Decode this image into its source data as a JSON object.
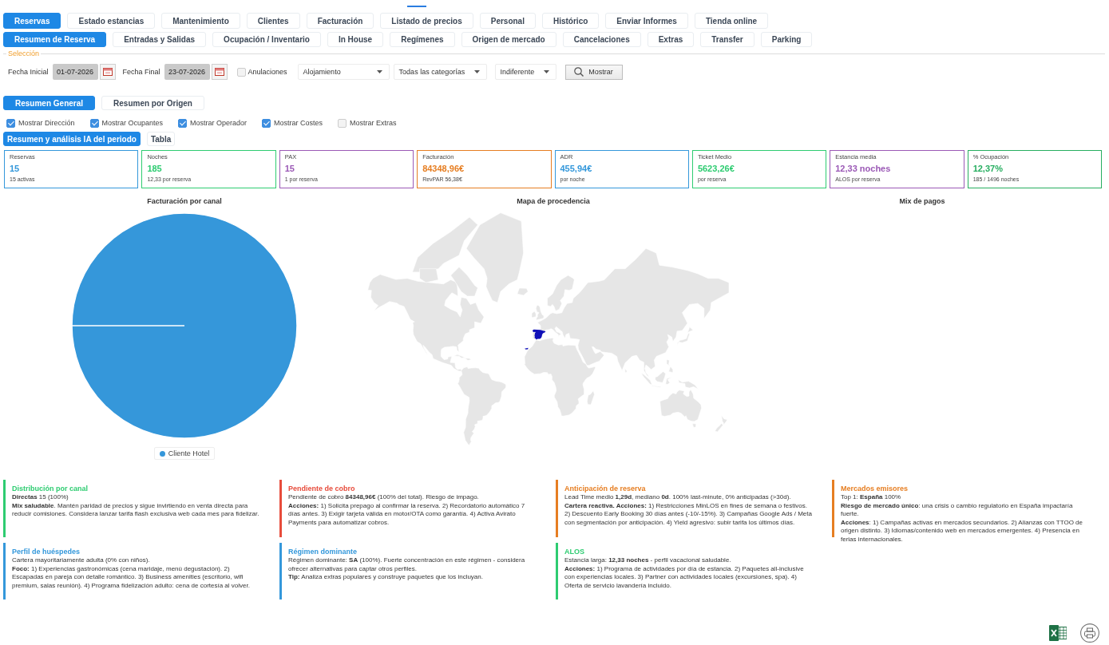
{
  "top_tabs": [
    {
      "label": "Reservas",
      "selected": true
    },
    {
      "label": "Estado estancias",
      "selected": false
    },
    {
      "label": "Mantenimiento",
      "selected": false
    },
    {
      "label": "Clientes",
      "selected": false
    },
    {
      "label": "Facturación",
      "selected": false
    },
    {
      "label": "Listado de precios",
      "selected": false
    },
    {
      "label": "Personal",
      "selected": false
    },
    {
      "label": "Histórico",
      "selected": false
    },
    {
      "label": "Enviar Informes",
      "selected": false
    },
    {
      "label": "Tienda online",
      "selected": false
    }
  ],
  "section_tabs": [
    {
      "label": "Resumen de Reserva",
      "selected": true
    },
    {
      "label": "Entradas y Salidas",
      "selected": false
    },
    {
      "label": "Ocupación / Inventario",
      "selected": false
    },
    {
      "label": "In House",
      "selected": false
    },
    {
      "label": "Regímenes",
      "selected": false
    },
    {
      "label": "Origen de mercado",
      "selected": false
    },
    {
      "label": "Cancelaciones",
      "selected": false
    },
    {
      "label": "Extras",
      "selected": false
    },
    {
      "label": "Transfer",
      "selected": false
    },
    {
      "label": "Parking",
      "selected": false
    }
  ],
  "selection": {
    "legend": "Selección",
    "start_date": {
      "label": "Fecha Inicial",
      "value": "01-07-2026"
    },
    "end_date": {
      "label": "Fecha Final",
      "value": "23-07-2026"
    },
    "cancellations": {
      "label": "Anulaciones",
      "checked": false
    },
    "dropdowns": [
      {
        "value": "Alojamiento"
      },
      {
        "value": "Todas las categorías"
      },
      {
        "value": "Indiferente"
      }
    ],
    "show_button": {
      "label": "Mostrar"
    }
  },
  "view_tabs": [
    {
      "label": "Resumen General",
      "selected": true
    },
    {
      "label": "Resumen por Origen",
      "selected": false
    }
  ],
  "display_options": [
    {
      "label": "Mostrar Dirección",
      "checked": true
    },
    {
      "label": "Mostrar Ocupantes",
      "checked": true
    },
    {
      "label": "Mostrar Operador",
      "checked": true
    },
    {
      "label": "Mostrar Costes",
      "checked": true
    },
    {
      "label": "Mostrar Extras",
      "checked": false
    }
  ],
  "analysis_tabs": [
    {
      "label": "Resumen y análisis IA del periodo",
      "selected": true
    },
    {
      "label": "Tabla",
      "selected": false
    }
  ],
  "kpis": [
    {
      "label": "Reservas",
      "value": "15",
      "note": "15 activas",
      "color": "#3498db"
    },
    {
      "label": "Noches",
      "value": "185",
      "note": "12,33 por reserva",
      "color": "#2ecc71"
    },
    {
      "label": "PAX",
      "value": "15",
      "note": "1 por reserva",
      "color": "#9b59b6"
    },
    {
      "label": "Facturación",
      "value": "84348,96€",
      "note": "RevPAR 56,38€",
      "color": "#e67e22"
    },
    {
      "label": "ADR",
      "value": "455,94€",
      "note": "por noche",
      "color": "#3498db"
    },
    {
      "label": "Ticket Medio",
      "value": "5623,26€",
      "note": "por reserva",
      "color": "#2ecc71"
    },
    {
      "label": "Estancia media",
      "value": "12,33 noches",
      "note": "ALOS por reserva",
      "color": "#9b59b6"
    },
    {
      "label": "% Ocupación",
      "value": "12,37%",
      "note": "185 / 1496 noches",
      "color": "#27ae60"
    }
  ],
  "revenue_chart": {
    "chart_data": {
      "type": "pie",
      "title": "Facturación por canal",
      "categories": [
        "Cliente Hotel"
      ]
    }
  },
  "origin_map": {
    "title": "Mapa de procedencia"
  },
  "payment_mix": {
    "title": "Mix de pagos"
  },
  "insights": [
    {
      "title": "Distribución por canal",
      "color": "#2ecc71",
      "lines": [
        "**Directas** 15 (100%)",
        "**Mix saludable**. Mantén paridad de precios y sigue invirtiendo en venta directa para reducir comisiones. Considera lanzar tarifa flash exclusiva web cada mes para fidelizar."
      ]
    },
    {
      "title": "Pendiente de cobro",
      "color": "#e74c3c",
      "lines": [
        "Pendiente de cobro **84348,96€** (100% del total). Riesgo de impago.",
        "**Acciones:** 1) Solicita prepago al confirmar la reserva. 2) Recordatorio automático 7 días antes. 3) Exigir tarjeta válida en motor/OTA como garantía. 4) Activa Avirato Payments para automatizar cobros."
      ]
    },
    {
      "title": "Anticipación de reserva",
      "color": "#e67e22",
      "lines": [
        "Lead Time medio **1,29d**, mediano **0d**. 100% last-minute, 0% anticipadas (>30d).",
        "**Cartera reactiva. Acciones:** 1) Restricciones MinLOS en fines de semana o festivos. 2) Descuento Early Booking 30 días antes (-10/-15%). 3) Campañas Google Ads / Meta con segmentación por anticipación. 4) Yield agresivo: subir tarifa los últimos días."
      ]
    },
    {
      "title": "Mercados emisores",
      "color": "#e67e22",
      "lines": [
        "Top 1: **España** 100%",
        "**Riesgo de mercado único**: una crisis o cambio regulatorio en España impactaría fuerte.",
        "**Acciones**: 1) Campañas activas en mercados secundarios. 2) Alianzas con TTOO de origen distinto. 3) Idiomas/contenido web en mercados emergentes. 4) Presencia en ferias internacionales."
      ]
    },
    {
      "title": "Perfil de huéspedes",
      "color": "#3498db",
      "lines": [
        "Cartera mayoritariamente adulta (0% con niños).",
        "**Foco:** 1) Experiencias gastronómicas (cena maridaje, menú degustación). 2) Escapadas en pareja con detalle romántico. 3) Business amenities (escritorio, wifi premium, salas reunión). 4) Programa fidelización adulto: cena de cortesía al volver."
      ]
    },
    {
      "title": "Régimen dominante",
      "color": "#3498db",
      "lines": [
        "Régimen dominante: **SA** (100%). Fuerte concentración en este régimen - considera ofrecer alternativas para captar otros perfiles.",
        "**Tip:** Analiza extras populares y construye paquetes que los incluyan."
      ]
    },
    {
      "title": "ALOS",
      "color": "#2ecc71",
      "lines": [
        "Estancia larga: **12,33 noches** - perfil vacacional saludable.",
        "**Acciones:** 1) Programa de actividades por día de estancia. 2) Paquetes all-inclusive con experiencias locales. 3) Partner con actividades locales (excursiones, spa). 4) Oferta de servicio lavandería incluido."
      ]
    }
  ]
}
